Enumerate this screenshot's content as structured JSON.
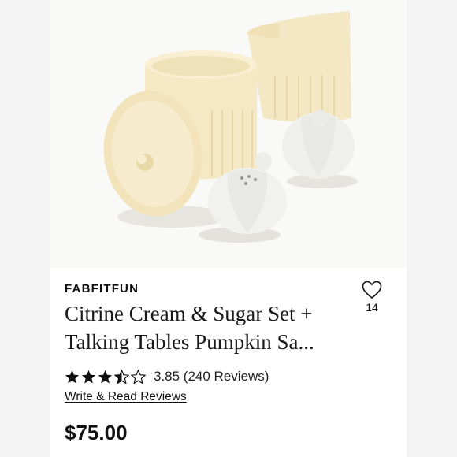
{
  "product": {
    "brand": "FABFITFUN",
    "title": "Citrine Cream & Sugar Set + Talking Tables Pumpkin Sa...",
    "favorite_count": "14",
    "rating_value": 3.85,
    "rating_text": "3.85 (240 Reviews)",
    "reviews_link": "Write & Read Reviews",
    "price": "$75.00"
  },
  "icons": {
    "favorite": "heart-outline-icon",
    "star_full": "star-full-icon",
    "star_half": "star-half-icon",
    "star_empty": "star-empty-icon"
  },
  "colors": {
    "cream": "#f3e6bf",
    "white_ceramic": "#f1f1ef",
    "text": "#111111"
  }
}
